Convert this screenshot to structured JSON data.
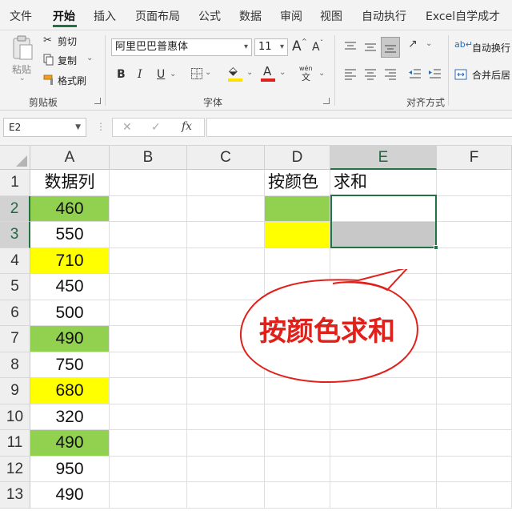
{
  "tabs": [
    "文件",
    "开始",
    "插入",
    "页面布局",
    "公式",
    "数据",
    "审阅",
    "视图",
    "自动执行",
    "Excel自学成才"
  ],
  "active_tab": "开始",
  "ribbon": {
    "clipboard": {
      "paste": "粘贴",
      "cut": "剪切",
      "copy": "复制",
      "format_painter": "格式刷",
      "label": "剪贴板"
    },
    "font": {
      "name": "阿里巴巴普惠体",
      "size": "11",
      "grow": "A",
      "shrink": "A",
      "bold": "B",
      "italic": "I",
      "underline": "U",
      "font_color_letter": "A",
      "phonetic": "wén",
      "label": "字体",
      "fill_color": "#ffe000",
      "font_color": "#e0201a"
    },
    "alignment": {
      "wrap_text": "自动换行",
      "merge_center": "合并后居",
      "label": "对齐方式"
    }
  },
  "formula_bar": {
    "name_box": "E2",
    "cancel": "✕",
    "enter": "✓",
    "fx": "fx",
    "value": ""
  },
  "columns": [
    "A",
    "B",
    "C",
    "D",
    "E",
    "F"
  ],
  "selected_column": "E",
  "rows": [
    "1",
    "2",
    "3",
    "4",
    "5",
    "6",
    "7",
    "8",
    "9",
    "10",
    "11",
    "12",
    "13"
  ],
  "cells": {
    "A": [
      "数据列",
      "460",
      "550",
      "710",
      "450",
      "500",
      "490",
      "750",
      "680",
      "320",
      "490",
      "950",
      "490"
    ],
    "D1": "按颜色",
    "E1": "求和"
  },
  "colors": {
    "green": "#92d050",
    "yellow": "#ffff00",
    "gray": "#c8c8c8",
    "accent": "#217346"
  },
  "a_fills": [
    "",
    "green",
    "",
    "yellow",
    "",
    "",
    "green",
    "",
    "yellow",
    "",
    "green",
    "",
    ""
  ],
  "callout": {
    "text": "按颜色求和"
  }
}
